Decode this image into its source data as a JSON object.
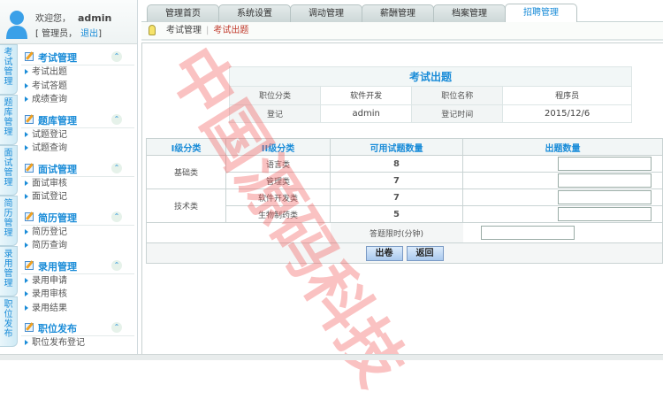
{
  "user": {
    "welcome": "欢迎您，",
    "name": "admin",
    "role_prefix": "[ 管理员，",
    "logout": "退出",
    "role_suffix": "]"
  },
  "vtabs": [
    "考试管理",
    "题库管理",
    "面试管理",
    "简历管理",
    "录用管理",
    "职位发布"
  ],
  "menu": [
    {
      "title": "考试管理",
      "items": [
        "考试出题",
        "考试答题",
        "成绩查询"
      ]
    },
    {
      "title": "题库管理",
      "items": [
        "试题登记",
        "试题查询"
      ]
    },
    {
      "title": "面试管理",
      "items": [
        "面试审核",
        "面试登记"
      ]
    },
    {
      "title": "简历管理",
      "items": [
        "简历登记",
        "简历查询"
      ]
    },
    {
      "title": "录用管理",
      "items": [
        "录用申请",
        "录用审核",
        "录用结果"
      ]
    },
    {
      "title": "职位发布",
      "items": [
        "职位发布登记"
      ]
    }
  ],
  "tabs": [
    "管理首页",
    "系统设置",
    "调动管理",
    "薪酬管理",
    "档案管理",
    "招聘管理"
  ],
  "breadcrumb": {
    "parent": "考试管理",
    "current": "考试出题"
  },
  "info": {
    "title": "考试出题",
    "l1": "职位分类",
    "v1": "软件开发",
    "l2": "职位名称",
    "v2": "程序员",
    "l3": "登记",
    "v3": "admin",
    "l4": "登记时间",
    "v4": "2015/12/6"
  },
  "questions": {
    "headers": [
      "I级分类",
      "II级分类",
      "可用试题数量",
      "出题数量"
    ],
    "groups": [
      {
        "name": "基础类",
        "rows": [
          {
            "sub": "语言类",
            "count": "8"
          },
          {
            "sub": "管理类",
            "count": "7"
          }
        ]
      },
      {
        "name": "技术类",
        "rows": [
          {
            "sub": "软件开发类",
            "count": "7"
          },
          {
            "sub": "生物制药类",
            "count": "5"
          }
        ]
      }
    ],
    "time_limit_label": "答题限时(分钟)",
    "submit": "出卷",
    "back": "返回"
  },
  "watermark": "中国源码科技"
}
